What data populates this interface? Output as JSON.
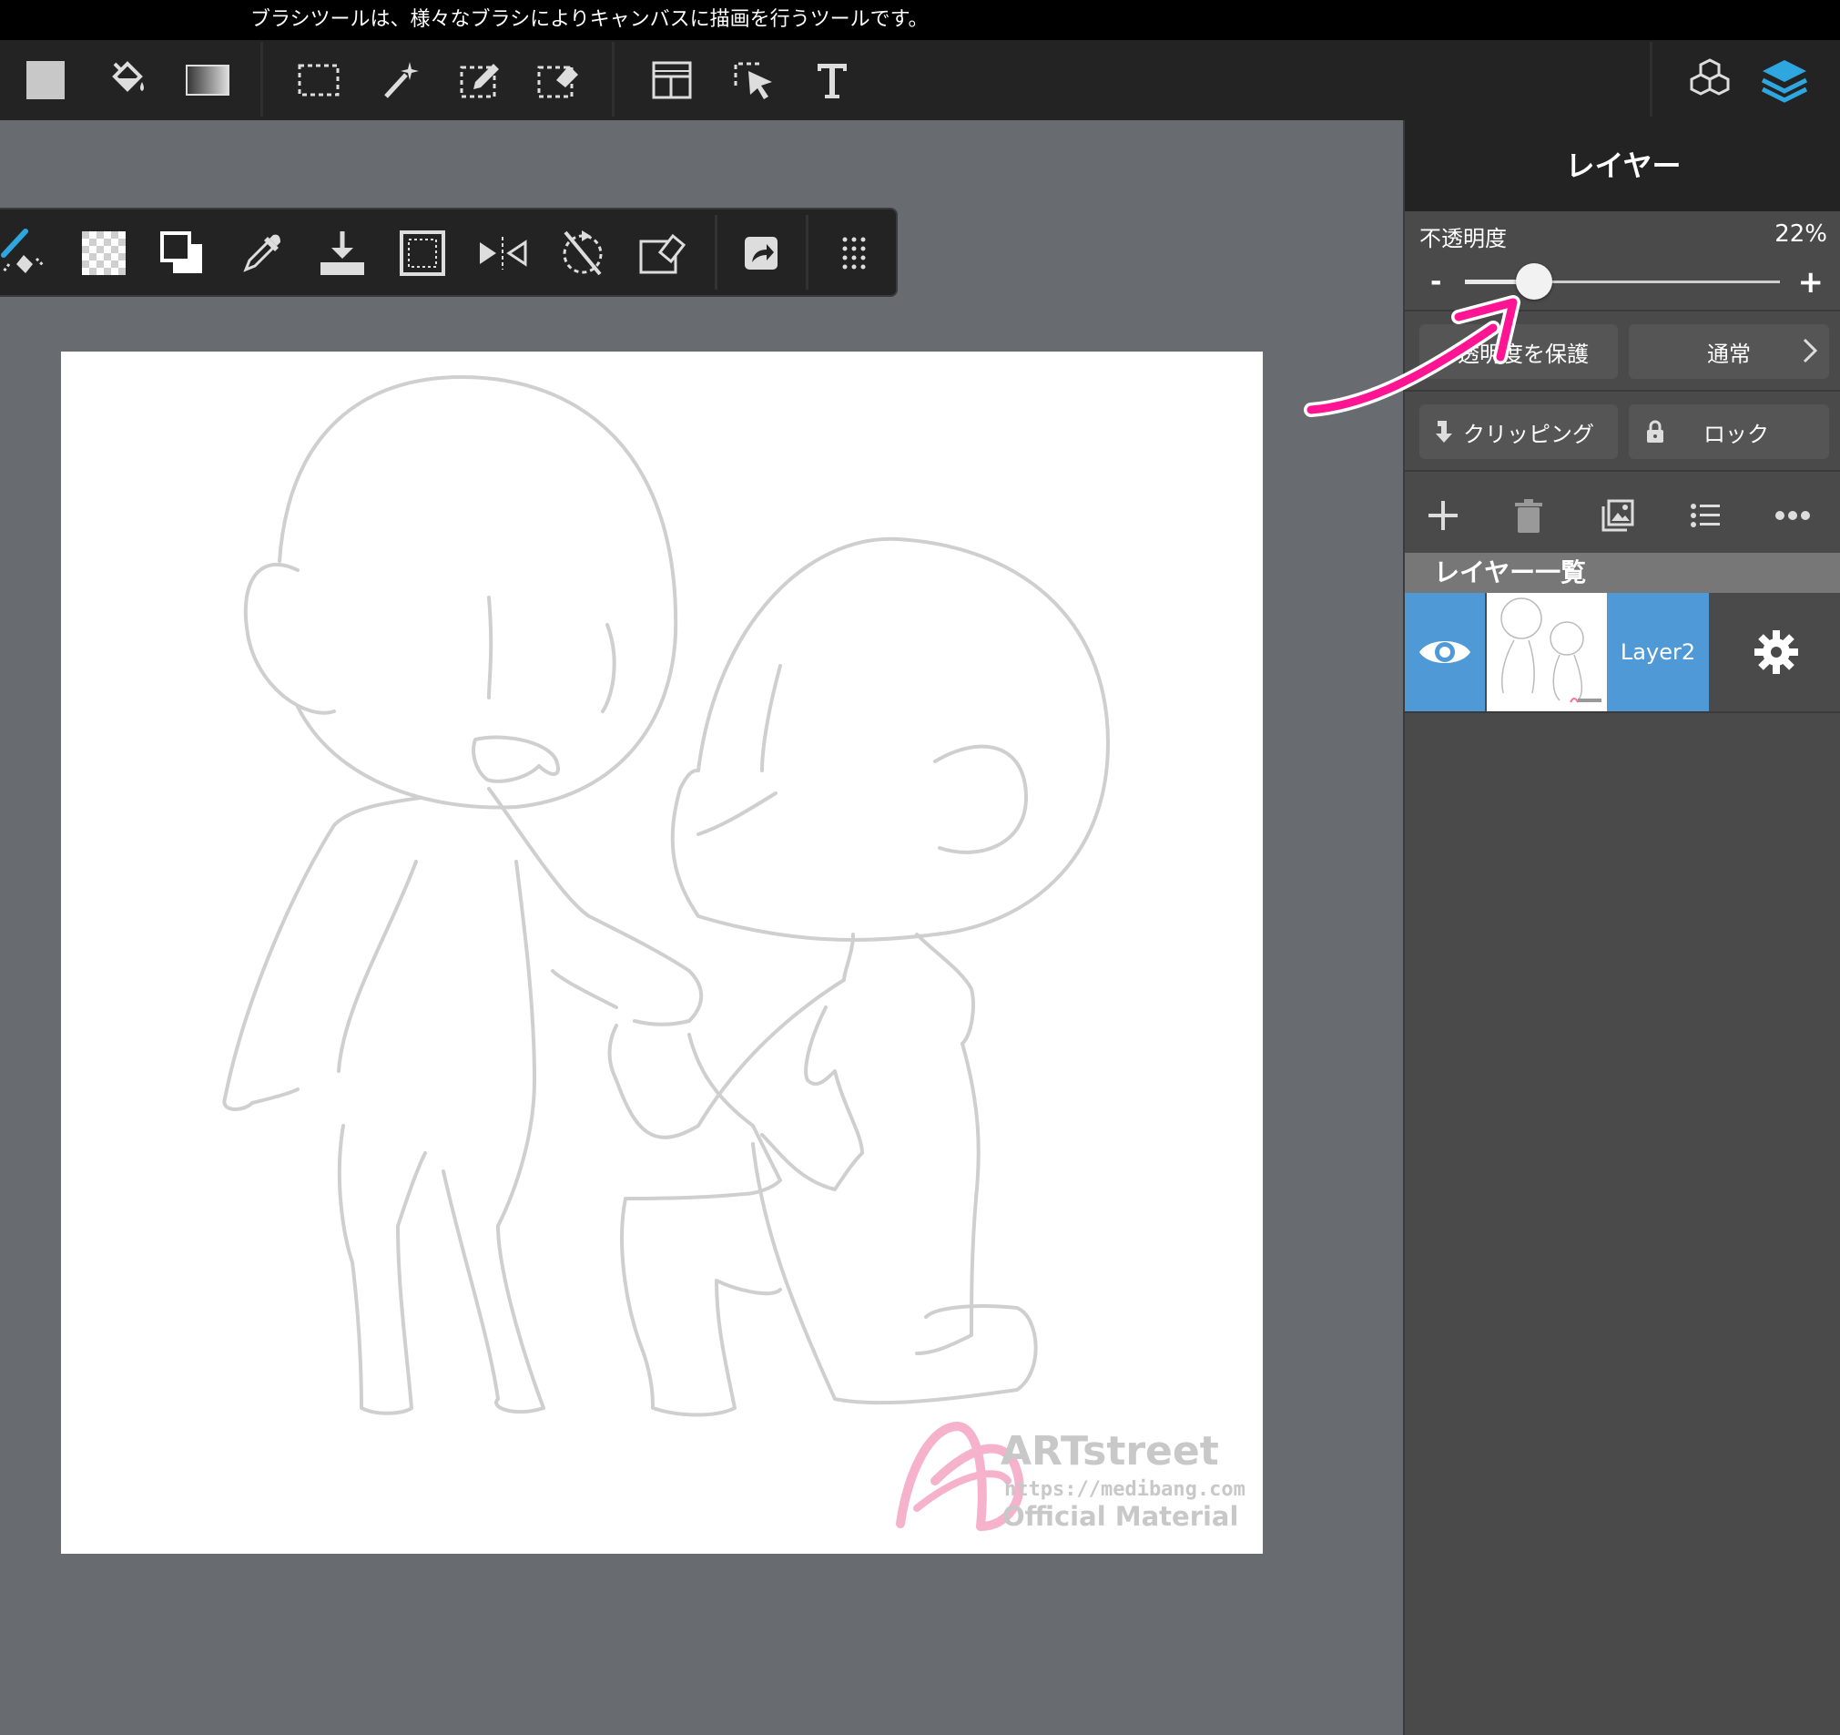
{
  "tip_text": "ブラシツールは、様々なブラシによりキャンバスに描画を行うツールです。",
  "toolbar": {
    "left_icons": [
      "color-swatch-icon",
      "bucket-fill-icon",
      "gradient-icon",
      "rect-select-icon",
      "magic-wand-icon",
      "select-pen-icon",
      "select-eraser-icon",
      "divide-panel-icon",
      "operation-tool-icon",
      "text-tool-icon"
    ],
    "right_icons": [
      "material-cubes-icon",
      "layers-icon"
    ],
    "accent_color": "#2ea6df"
  },
  "subbar": {
    "icons": [
      "brush-eraser-icon",
      "transparent-color-icon",
      "swap-colors-icon",
      "eyedropper-icon",
      "download-icon",
      "canvas-frame-icon",
      "flip-icon",
      "rotate-reset-icon",
      "clear-selection-icon",
      "share-icon",
      "more-grid-icon"
    ]
  },
  "canvas": {
    "watermark": {
      "brand": "ARTstreet",
      "url": "https://medibang.com",
      "tagline": "Official Material"
    }
  },
  "layer_panel": {
    "title": "レイヤー",
    "opacity_label": "不透明度",
    "opacity_value": "22%",
    "opacity_fraction": 0.22,
    "minus": "-",
    "plus": "+",
    "protect_alpha_label": "透明度を保護",
    "blend_mode_label": "通常",
    "clipping_label": "クリッピング",
    "lock_label": "ロック",
    "action_icons": [
      "add-layer-icon",
      "delete-layer-icon",
      "import-image-icon",
      "list-icon",
      "more-icon"
    ],
    "list_title": "レイヤー一覧",
    "layers": [
      {
        "name": "Layer2",
        "visible": true,
        "selected": true
      }
    ],
    "highlight_color": "#4f99d6",
    "arrow_color": "#ff1493"
  }
}
